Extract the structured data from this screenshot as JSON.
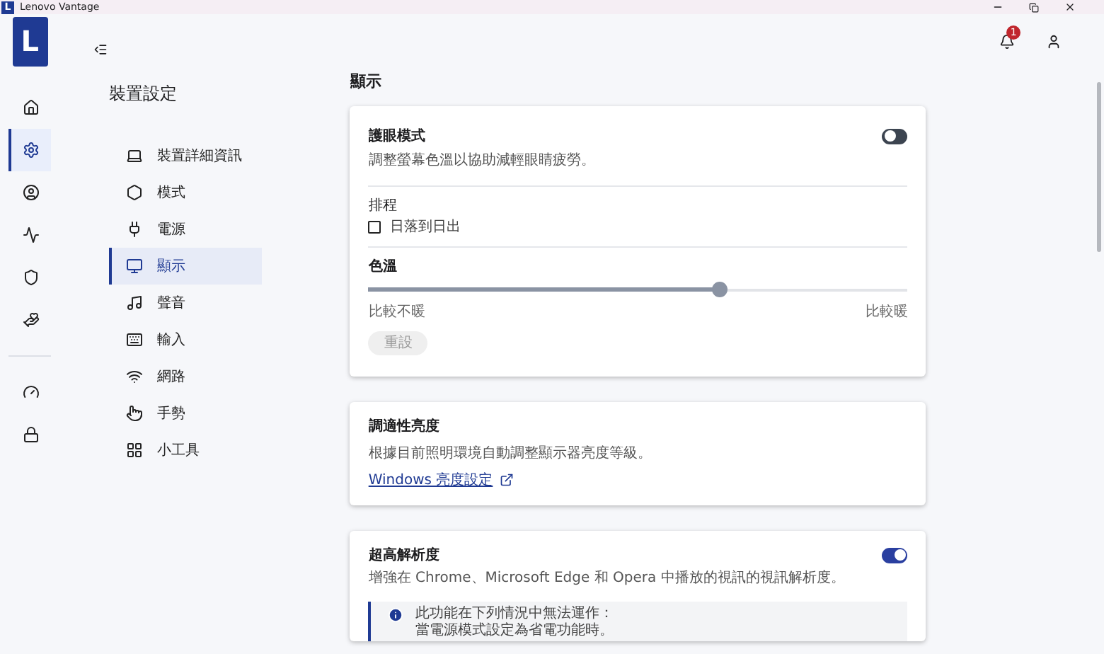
{
  "window": {
    "icon": "L",
    "title": "Lenovo Vantage"
  },
  "header": {
    "logo": "L",
    "notification_count": "1"
  },
  "rail": {
    "items": [
      {
        "selected": false
      },
      {
        "selected": true
      },
      {
        "selected": false
      },
      {
        "selected": false
      },
      {
        "selected": false
      },
      {
        "selected": false
      },
      {
        "selected": false
      },
      {
        "selected": false
      }
    ]
  },
  "nav": {
    "title": "裝置設定",
    "items": [
      {
        "label": "裝置詳細資訊",
        "selected": false
      },
      {
        "label": "模式",
        "selected": false
      },
      {
        "label": "電源",
        "selected": false
      },
      {
        "label": "顯示",
        "selected": true
      },
      {
        "label": "聲音",
        "selected": false
      },
      {
        "label": "輸入",
        "selected": false
      },
      {
        "label": "網路",
        "selected": false
      },
      {
        "label": "手勢",
        "selected": false
      },
      {
        "label": "小工具",
        "selected": false
      }
    ]
  },
  "page_title": "顯示",
  "eye_care": {
    "title": "護眼模式",
    "description": "調整螢幕色溫以協助減輕眼睛疲勞。",
    "on": false,
    "schedule_label": "排程",
    "schedule_checkbox": {
      "label": "日落到日出",
      "checked": false
    },
    "color_temperature": {
      "label": "色溫",
      "level": 0.65,
      "min_label": "比較不暖",
      "max_label": "比較暖"
    },
    "reset_button": {
      "label": "重設",
      "disabled": true
    }
  },
  "adaptive_brightness": {
    "title": "調適性亮度",
    "description": "根據目前照明環境自動調整顯示器亮度等級。",
    "link": "Windows 亮度設定"
  },
  "super_resolution": {
    "title": "超高解析度",
    "description": "增強在 Chrome、Microsoft Edge 和 Opera 中播放的視訊的視訊解析度。",
    "on": true,
    "info_lines": [
      "此功能在下列情況中無法運作：",
      "當電源模式設定為省電功能時。"
    ]
  }
}
